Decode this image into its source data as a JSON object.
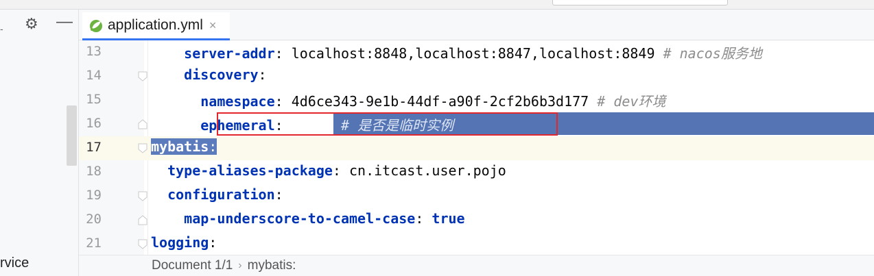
{
  "window": {
    "project_pane_label": "rvice"
  },
  "tabs": [
    {
      "label": "application.yml",
      "close": "×",
      "icon": "spring-leaf-icon"
    }
  ],
  "toolbar": {
    "gear_icon": "⚙",
    "minimize_icon": "—",
    "dash": "-"
  },
  "editor": {
    "lines": [
      {
        "num": "13",
        "key": "server-addr",
        "value": " localhost:8848,localhost:8847,localhost:8849 ",
        "comment": "# nacos服务地",
        "indent": "    "
      },
      {
        "num": "14",
        "key": "discovery",
        "value": "",
        "comment": "",
        "indent": "    "
      },
      {
        "num": "15",
        "key": "namespace",
        "value": " 4d6ce343-9e1b-44df-a90f-2cf2b6b3d177 ",
        "comment": "# dev环境",
        "indent": "      "
      },
      {
        "num": "16",
        "key": "ephemeral",
        "value": "false",
        "comment": "# 是否是临时实例",
        "indent": "      "
      },
      {
        "num": "17",
        "key": "mybatis",
        "value": "",
        "comment": "",
        "indent": ""
      },
      {
        "num": "18",
        "key": "type-aliases-package",
        "value": " cn.itcast.user.pojo",
        "comment": "",
        "indent": "  "
      },
      {
        "num": "19",
        "key": "configuration",
        "value": "",
        "comment": "",
        "indent": "  "
      },
      {
        "num": "20",
        "key": "map-underscore-to-camel-case",
        "value": "true",
        "comment": "",
        "indent": "    "
      },
      {
        "num": "21",
        "key": "logging",
        "value": "",
        "comment": "",
        "indent": ""
      }
    ]
  },
  "breadcrumb": {
    "document": "Document 1/1",
    "separator": "›",
    "path": "mybatis:"
  },
  "colors": {
    "selection": "#2f65ca",
    "highlight_box": "#e3262a",
    "keyword": "#0033b3",
    "comment": "#8c8c8c"
  }
}
